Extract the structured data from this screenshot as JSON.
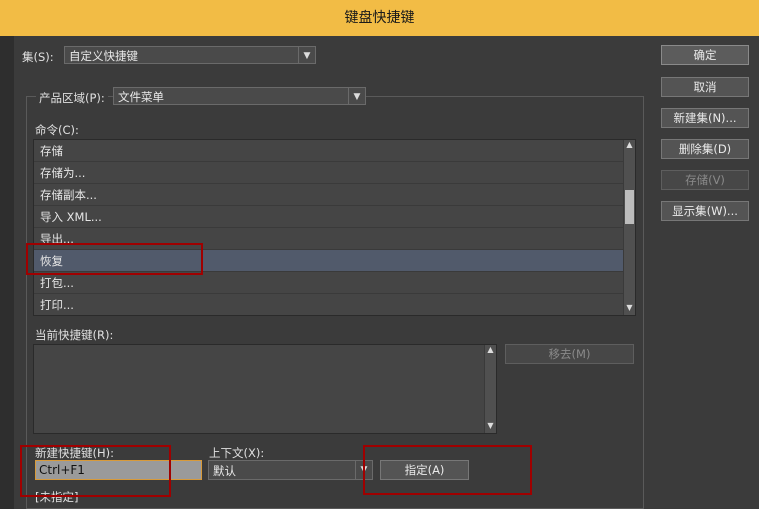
{
  "title": "键盘快捷键",
  "set": {
    "label": "集(S):",
    "value": "自定义快捷键"
  },
  "product_area": {
    "label": "产品区域(P):",
    "value": "文件菜单"
  },
  "commands": {
    "label": "命令(C):",
    "items": [
      "存储",
      "存储为...",
      "存储副本...",
      "导入 XML...",
      "导出...",
      "恢复",
      "打包...",
      "打印..."
    ],
    "selected_index": 5
  },
  "current_shortcut": {
    "label": "当前快捷键(R):",
    "remove_label": "移去(M)"
  },
  "new_shortcut": {
    "label": "新建快捷键(H):",
    "value": "Ctrl+F1"
  },
  "context": {
    "label": "上下文(X):",
    "value": "默认"
  },
  "assign_label": "指定(A)",
  "unassigned_label": "[未指定]",
  "buttons": {
    "ok": "确定",
    "cancel": "取消",
    "new_set": "新建集(N)...",
    "delete_set": "删除集(D)",
    "save": "存储(V)",
    "show_set": "显示集(W)..."
  },
  "colors": {
    "title_bar": "#f2bc45",
    "highlight": "#a00000",
    "selected_row": "#515a6b"
  }
}
